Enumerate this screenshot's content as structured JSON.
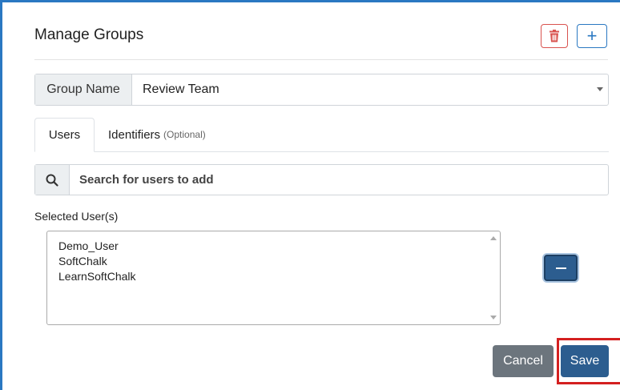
{
  "dialog": {
    "title": "Manage Groups",
    "delete_icon": "trash-icon",
    "add_icon": "plus-icon",
    "add_label": "+"
  },
  "group": {
    "label": "Group Name",
    "value": "Review Team"
  },
  "tabs": [
    {
      "label": "Users",
      "active": true
    },
    {
      "label": "Identifiers",
      "suffix": "(Optional)",
      "active": false
    }
  ],
  "search": {
    "icon": "search-icon",
    "placeholder": "Search for users to add"
  },
  "selected_users": {
    "label": "Selected User(s)",
    "items": [
      "Demo_User",
      "SoftChalk",
      "LearnSoftChalk"
    ]
  },
  "actions": {
    "cancel_label": "Cancel",
    "save_label": "Save"
  },
  "colors": {
    "accent": "#2c5d8f",
    "danger": "#d9534f",
    "highlight": "#d42020"
  }
}
